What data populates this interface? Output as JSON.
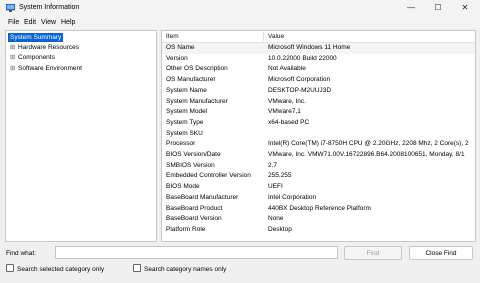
{
  "window": {
    "title": "System Information",
    "icon": "system-information-icon",
    "controls": {
      "minimize": "—",
      "maximize": "☐",
      "close": "✕"
    }
  },
  "menu": [
    "File",
    "Edit",
    "View",
    "Help"
  ],
  "tree": [
    {
      "label": "System Summary",
      "expander": "",
      "selected": true
    },
    {
      "label": "Hardware Resources",
      "expander": "⊞",
      "selected": false
    },
    {
      "label": "Components",
      "expander": "⊞",
      "selected": false
    },
    {
      "label": "Software Environment",
      "expander": "⊞",
      "selected": false
    }
  ],
  "table": {
    "headers": [
      "Item",
      "Value"
    ],
    "rows": [
      [
        "OS Name",
        "Microsoft Windows 11 Home"
      ],
      [
        "Version",
        "10.0.22000 Build 22000"
      ],
      [
        "Other OS Description",
        "Not Available"
      ],
      [
        "OS Manufacturer",
        "Microsoft Corporation"
      ],
      [
        "System Name",
        "DESKTOP-M2UUJ3D"
      ],
      [
        "System Manufacturer",
        "VMware, Inc."
      ],
      [
        "System Model",
        "VMware7,1"
      ],
      [
        "System Type",
        "x64-based PC"
      ],
      [
        "System SKU",
        ""
      ],
      [
        "Processor",
        "Intel(R) Core(TM) i7-8750H CPU @ 2.20GHz, 2208 Mhz, 2 Core(s), 2"
      ],
      [
        "BIOS Version/Date",
        "VMware, Inc. VMW71.00V.16722896.B64.2008100651, Monday, 8/1"
      ],
      [
        "SMBIOS Version",
        "2.7"
      ],
      [
        "Embedded Controller Version",
        "255.255"
      ],
      [
        "BIOS Mode",
        "UEFI"
      ],
      [
        "BaseBoard Manufacturer",
        "Intel Corporation"
      ],
      [
        "BaseBoard Product",
        "440BX Desktop Reference Platform"
      ],
      [
        "BaseBoard Version",
        "None"
      ],
      [
        "Platform Role",
        "Desktop"
      ]
    ]
  },
  "find": {
    "label": "Find what:",
    "value": "",
    "find_button": "Find",
    "close_find_button": "Close Find",
    "option_selected_category": "Search selected category only",
    "option_category_names": "Search category names only"
  },
  "colors": {
    "selection": "#0a64d6",
    "accent": "#0a64d6"
  }
}
